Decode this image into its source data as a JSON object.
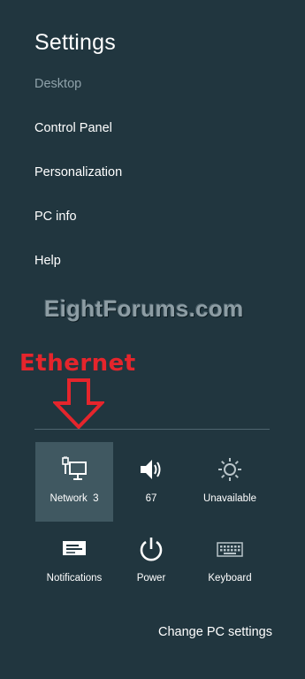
{
  "panel": {
    "title": "Settings",
    "menu": [
      {
        "label": "Desktop"
      },
      {
        "label": "Control Panel"
      },
      {
        "label": "Personalization"
      },
      {
        "label": "PC info"
      },
      {
        "label": "Help"
      }
    ]
  },
  "watermark": "EightForums.com",
  "annotation": {
    "text": "Ethernet",
    "color": "#e5252c"
  },
  "quick_settings": [
    {
      "label": "Network  3",
      "icon": "ethernet-network-icon",
      "selected": true
    },
    {
      "label": "67",
      "icon": "volume-icon"
    },
    {
      "label": "Unavailable",
      "icon": "brightness-icon"
    },
    {
      "label": "Notifications",
      "icon": "notifications-icon"
    },
    {
      "label": "Power",
      "icon": "power-icon"
    },
    {
      "label": "Keyboard",
      "icon": "keyboard-icon"
    }
  ],
  "footer": {
    "change_pc_settings": "Change PC settings"
  },
  "colors": {
    "background": "#21363f",
    "selected_tile": "#405861",
    "accent_red": "#e5252c"
  }
}
